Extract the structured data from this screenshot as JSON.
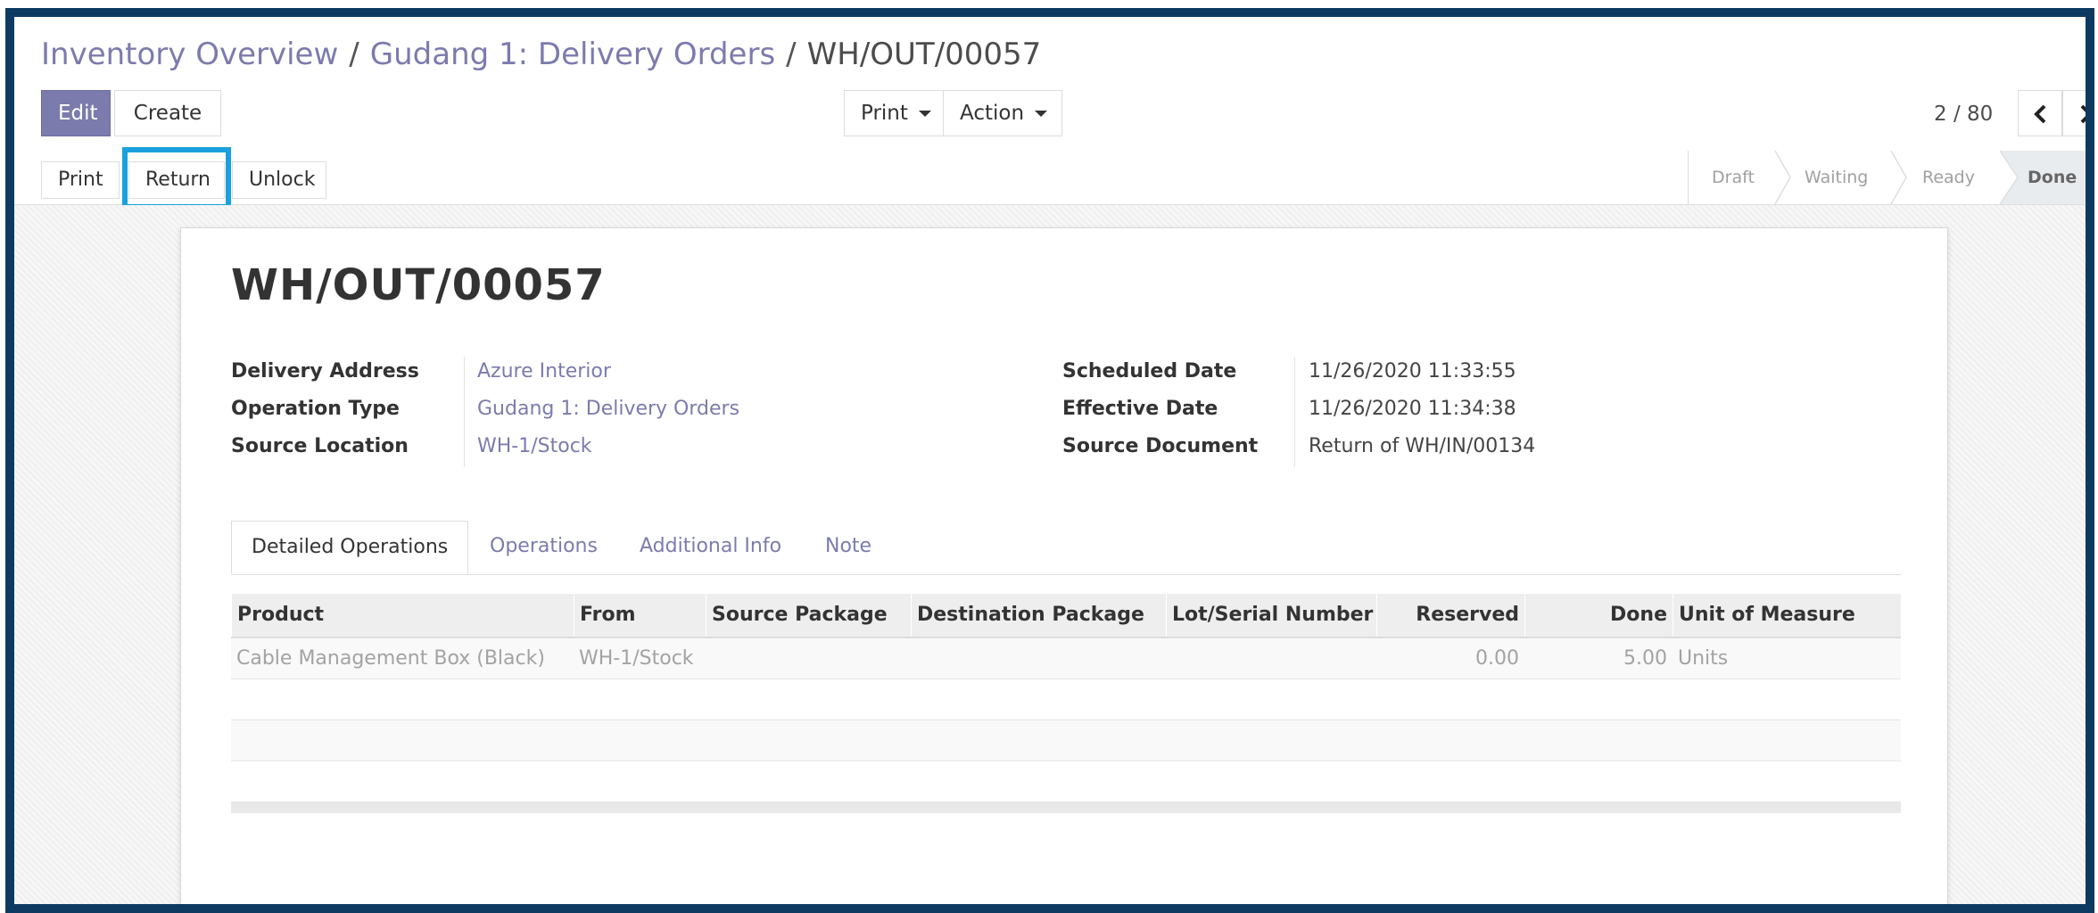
{
  "breadcrumb": {
    "items": [
      "Inventory Overview",
      "Gudang 1: Delivery Orders"
    ],
    "separator": "/",
    "current": "WH/OUT/00057"
  },
  "toolbar": {
    "edit_label": "Edit",
    "create_label": "Create",
    "print_dropdown_label": "Print",
    "action_dropdown_label": "Action"
  },
  "pager": {
    "text": "2 / 80"
  },
  "form_actions": {
    "print_label": "Print",
    "return_label": "Return",
    "unlock_label": "Unlock"
  },
  "status": {
    "steps": [
      "Draft",
      "Waiting",
      "Ready",
      "Done"
    ],
    "current": "Done"
  },
  "record": {
    "title": "WH/OUT/00057",
    "left_fields": [
      {
        "label": "Delivery Address",
        "value": "Azure Interior"
      },
      {
        "label": "Operation Type",
        "value": "Gudang 1: Delivery Orders"
      },
      {
        "label": "Source Location",
        "value": "WH-1/Stock"
      }
    ],
    "right_fields": [
      {
        "label": "Scheduled Date",
        "value": "11/26/2020 11:33:55"
      },
      {
        "label": "Effective Date",
        "value": "11/26/2020 11:34:38"
      },
      {
        "label": "Source Document",
        "value": "Return of WH/IN/00134"
      }
    ]
  },
  "tabs": [
    "Detailed Operations",
    "Operations",
    "Additional Info",
    "Note"
  ],
  "table": {
    "columns": [
      "Product",
      "From",
      "Source Package",
      "Destination Package",
      "Lot/Serial Number",
      "Reserved",
      "Done",
      "Unit of Measure"
    ],
    "rows": [
      [
        "Cable Management Box (Black)",
        "WH-1/Stock",
        "",
        "",
        "",
        "0.00",
        "5.00",
        "Units"
      ]
    ]
  },
  "colors": {
    "primary": "#7c7bad",
    "frame_border": "#0d3a60",
    "highlight": "#1aa1dc"
  }
}
